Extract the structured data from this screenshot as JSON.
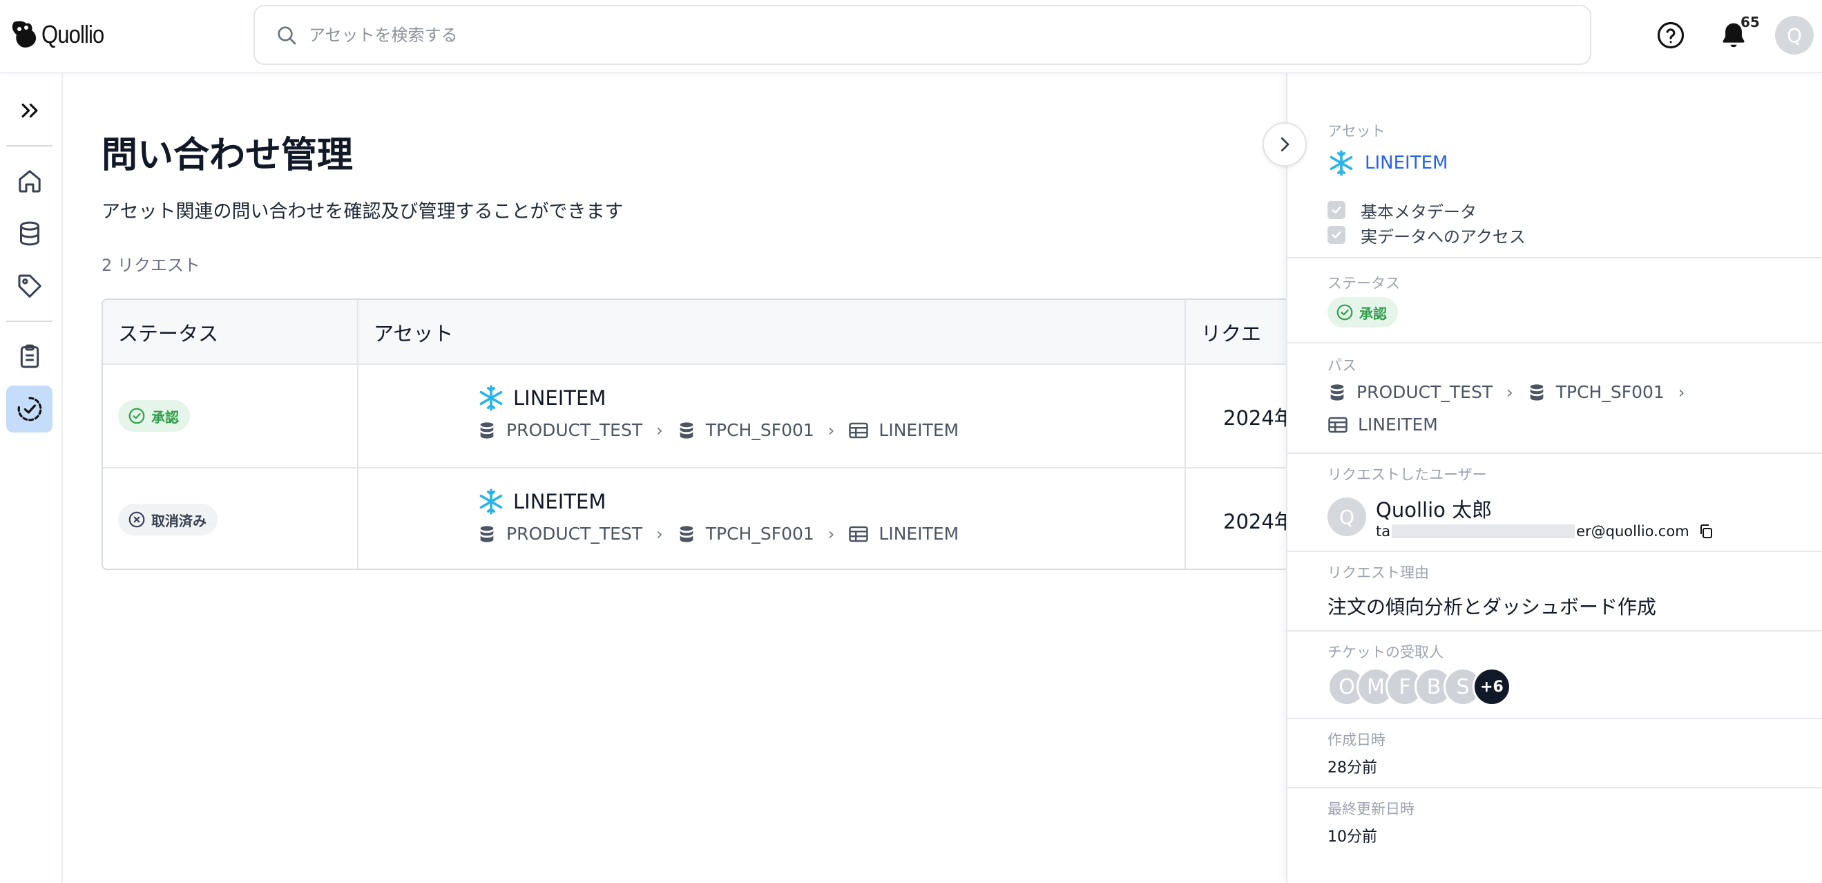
{
  "header": {
    "logo_text": "Quollio",
    "search_placeholder": "アセットを検索する",
    "notification_count": "65",
    "user_initial": "Q"
  },
  "page": {
    "title": "問い合わせ管理",
    "description": "アセット関連の問い合わせを確認及び管理することができます",
    "request_count": "2 リクエスト"
  },
  "table": {
    "columns": [
      "ステータス",
      "アセット",
      "リクエ"
    ],
    "rows": [
      {
        "status": "承認",
        "status_type": "approved",
        "asset_name": "LINEITEM",
        "path": [
          "PRODUCT_TEST",
          "TPCH_SF001",
          "LINEITEM"
        ],
        "date": "2024年"
      },
      {
        "status": "取消済み",
        "status_type": "cancelled",
        "asset_name": "LINEITEM",
        "path": [
          "PRODUCT_TEST",
          "TPCH_SF001",
          "LINEITEM"
        ],
        "date": "2024年"
      }
    ]
  },
  "panel": {
    "asset_label": "アセット",
    "asset_name": "LINEITEM",
    "checks": [
      "基本メタデータ",
      "実データへのアクセス"
    ],
    "status_label": "ステータス",
    "status_value": "承認",
    "path_label": "パス",
    "path": [
      "PRODUCT_TEST",
      "TPCH_SF001",
      "LINEITEM"
    ],
    "requester_label": "リクエストしたユーザー",
    "requester_initial": "Q",
    "requester_name": "Quollio 太郎",
    "requester_email_start": "ta",
    "requester_email_end": "er@quollio.com",
    "reason_label": "リクエスト理由",
    "reason_value": "注文の傾向分析とダッシュボード作成",
    "recipients_label": "チケットの受取人",
    "recipients": [
      "O",
      "M",
      "F",
      "B",
      "S"
    ],
    "recipients_more": "+6",
    "created_label": "作成日時",
    "created_value": "28分前",
    "updated_label": "最終更新日時",
    "updated_value": "10分前"
  },
  "colors": {
    "accent": "#2563eb",
    "approved_bg": "#e6f5ea",
    "approved_text": "#2f9e4a",
    "nav_active": "#c6dcfb",
    "snowflake": "#29b5e8"
  }
}
